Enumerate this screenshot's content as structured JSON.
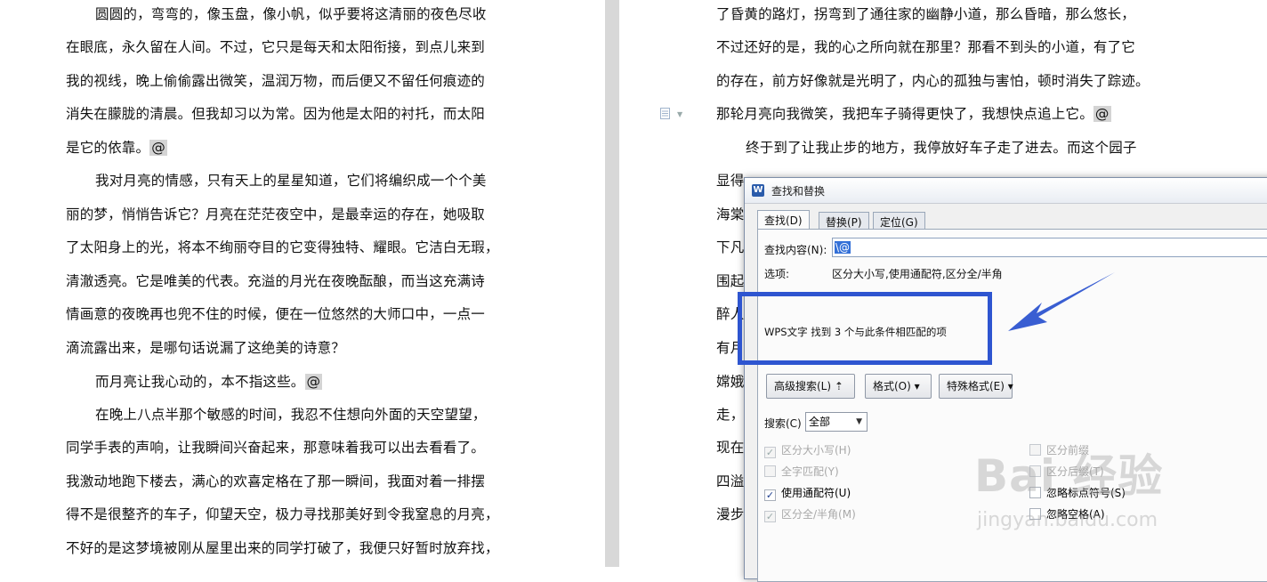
{
  "document_left": {
    "lines": [
      "圆圆的，弯弯的，像玉盘，像小帆，似乎要将这清丽的夜色尽收",
      "在眼底，永久留在人间。不过，它只是每天和太阳衔接，到点儿来到",
      "我的视线，晚上偷偷露出微笑，温润万物，而后便又不留任何痕迹的",
      "消失在朦胧的清晨。但我却习以为常。因为他是太阳的衬托，而太阳",
      "是它的依靠。",
      "我对月亮的情感，只有天上的星星知道，它们将编织成一个个美",
      "丽的梦，悄悄告诉它？月亮在茫茫夜空中，是最幸运的存在，她吸取",
      "了太阳身上的光，将本不绚丽夺目的它变得独特、耀眼。它洁白无瑕，",
      "清澈透亮。它是唯美的代表。充溢的月光在夜晚酝酿，而当这充满诗",
      "情画意的夜晚再也兜不住的时候，便在一位悠然的大师口中，一点一",
      "滴流露出来，是哪句话说漏了这绝美的诗意？",
      "而月亮让我心动的，本不指这些。",
      "在晚上八点半那个敏感的时间，我忍不住想向外面的天空望望，",
      "同学手表的声响，让我瞬间兴奋起来，那意味着我可以出去看看了。",
      "我激动地跑下楼去，满心的欢喜定格在了那一瞬间，我面对着一排摆",
      "得不是很整齐的车子，仰望天空，极力寻找那美好到令我窒息的月亮，",
      "不好的是这梦境被刚从屋里出来的同学打破了，我便只好暂时放弃找，"
    ],
    "mark": "@"
  },
  "document_right": {
    "lines": [
      "了昏黄的路灯，拐弯到了通往家的幽静小道，那么昏暗，那么悠长，",
      "不过还好的是，我的心之所向就在那里？那看不到头的小道，有了它",
      "的存在，前方好像就是光明了，内心的孤独与害怕，顿时消失了踪迹。",
      "那轮月亮向我微笑，我把车子骑得更快了，我想快点追上它。",
      "终于到了让我止步的地方，我停放好车子走了进去。而这个园子",
      "显得"
    ],
    "partial_lines": [
      "海棠",
      "下凡",
      "围起",
      "醉人",
      "有月",
      "嫦娥",
      "走，",
      "现在",
      "四溢",
      "漫步"
    ],
    "mark": "@"
  },
  "dialog": {
    "title": "查找和替换",
    "app_icon": "W",
    "tabs": [
      "查找(D)",
      "替换(P)",
      "定位(G)"
    ],
    "find_label": "查找内容(N):",
    "find_value": "\\@",
    "options_label": "选项:",
    "options_value": "区分大小写,使用通配符,区分全/半角",
    "result_text": "WPS文字 找到 3 个与此条件相匹配的项",
    "buttons": {
      "advanced": "高级搜索(L) ⇡",
      "format": "格式(O) ▾",
      "special": "特殊格式(E) ▾"
    },
    "search_label": "搜索(C)",
    "search_value": "全部",
    "checkboxes_left": [
      {
        "label": "区分大小写(H)",
        "checked": true,
        "disabled": true
      },
      {
        "label": "全字匹配(Y)",
        "checked": false,
        "disabled": true
      },
      {
        "label": "使用通配符(U)",
        "checked": true,
        "disabled": false
      },
      {
        "label": "区分全/半角(M)",
        "checked": true,
        "disabled": true
      }
    ],
    "checkboxes_right": [
      {
        "label": "区分前缀",
        "checked": false,
        "disabled": true
      },
      {
        "label": "区分后缀(T)",
        "checked": false,
        "disabled": true
      },
      {
        "label": "忽略标点符号(S)",
        "checked": false,
        "disabled": false
      },
      {
        "label": "忽略空格(A)",
        "checked": false,
        "disabled": false
      }
    ]
  },
  "watermark": {
    "brand": "Bai 经验",
    "url": "jingyan.baidu.com"
  },
  "annotation_color": "#2e55d0"
}
